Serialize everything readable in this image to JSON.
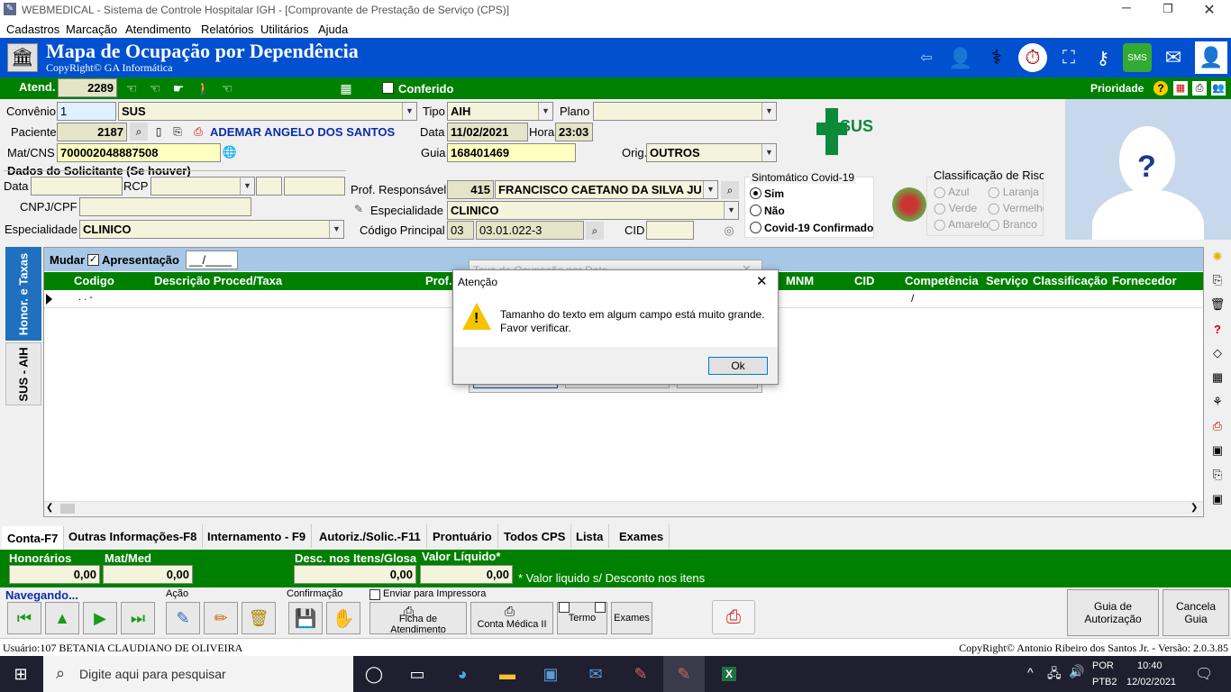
{
  "window": {
    "title": "WEBMEDICAL - Sistema de Controle Hospitalar IGH - [Comprovante de Prestação de Serviço  (CPS)]"
  },
  "menu": [
    "Cadastros",
    "Marcação",
    "Atendimento",
    "Relatórios",
    "Utilitários",
    "Ajuda"
  ],
  "header": {
    "title": "Mapa de Ocupação por Dependência",
    "subtitle": "CopyRight© GA Informática"
  },
  "atend": {
    "label": "Atend.",
    "value": "2289",
    "conferido": "Conferido",
    "prioridade": "Prioridade"
  },
  "form": {
    "convenio_label": "Convênio",
    "convenio_code": "1",
    "convenio_name": "SUS",
    "tipo_label": "Tipo",
    "tipo_value": "AIH",
    "plano_label": "Plano",
    "paciente_label": "Paciente",
    "paciente_code": "2187",
    "paciente_name": "ADEMAR ANGELO DOS SANTOS",
    "data_label": "Data",
    "data_value": "11/02/2021",
    "hora_label": "Hora",
    "hora_value": "23:03",
    "matcns_label": "Mat/CNS",
    "matcns_value": "700002048887508",
    "guia_label": "Guia",
    "guia_value": "168401469",
    "orig_label": "Orig.",
    "orig_value": "OUTROS",
    "solicitante_title": "Dados do Solicitante (Se houver)",
    "sol_data_label": "Data",
    "rcp_label": "RCP",
    "cnpj_label": "CNPJ/CPF",
    "esp_label": "Especialidade",
    "esp_value": "CLINICO",
    "prof_label": "Prof. Responsável",
    "prof_code": "415",
    "prof_name": "FRANCISCO CAETANO DA SILVA JU",
    "esp2_label": "Especialidade",
    "esp2_value": "CLINICO",
    "codproc_label": "Código Principal",
    "codproc_a": "03",
    "codproc_b": "03.01.022-3",
    "cid_label": "CID"
  },
  "covid": {
    "title": "Sintomático Covid-19",
    "options": [
      "Sim",
      "Não",
      "Covid-19 Confirmado"
    ]
  },
  "risco": {
    "title": "Classificação de Risco",
    "options": [
      "Azul",
      "Laranja",
      "Verde",
      "Vermelho",
      "Amarelo",
      "Branco"
    ]
  },
  "sus_logo": {
    "text": "SUS"
  },
  "side_tabs": [
    "Honor. e Taxas",
    "SUS - AIH"
  ],
  "grid_toolbar": {
    "mudar": "Mudar",
    "apresentacao": "Apresentação",
    "apresentacao_value": "__/____"
  },
  "grid": {
    "columns": [
      "Codigo",
      "Descrição Proced/Taxa",
      "Prof.",
      "MNM",
      "CID",
      "Competência",
      "Serviço",
      "Classificação",
      "Fornecedor"
    ],
    "row_code": ". .  -",
    "row_comp": "/"
  },
  "bg_dialog": {
    "title": "Taxa de Ocupação por Data"
  },
  "dialog": {
    "title": "Atenção",
    "message_1": "Tamanho do texto em algum campo está muito grande.",
    "message_2": "Favor verificar.",
    "ok": "Ok"
  },
  "bottom_tabs": [
    "Conta-F7",
    "Outras Informações-F8",
    "Internamento - F9",
    "Autoriz./Solic.-F11",
    "Prontuário",
    "Todos CPS",
    "Lista",
    "Exames"
  ],
  "totals": {
    "honorarios_label": "Honorários",
    "honorarios": "0,00",
    "matmed_label": "Mat/Med",
    "matmed": "0,00",
    "desc_label": "Desc. nos Itens/Glosa",
    "desc": "0,00",
    "liquido_label": "Valor Líquido*",
    "liquido": "0,00",
    "note": "* Valor liquido s/ Desconto nos itens"
  },
  "actions": {
    "navegando": "Navegando...",
    "acao": "Ação",
    "confirmacao": "Confirmação",
    "enviar": "Enviar para Impressora",
    "ficha": "Ficha de Atendimento",
    "conta": "Conta Médica II",
    "termo": "Termo",
    "exames": "Exames",
    "guia": "Guia de Autorização",
    "cancela": "Cancela Guia"
  },
  "status": {
    "user": "Usuário:107 BETANIA CLAUDIANO DE OLIVEIRA",
    "copyright": "CopyRight© Antonio Ribeiro dos Santos Jr. - Versão: 2.0.3.85"
  },
  "taskbar": {
    "search": "Digite aqui para pesquisar",
    "lang": "POR",
    "layout": "PTB2",
    "time": "10:40",
    "date": "12/02/2021"
  }
}
